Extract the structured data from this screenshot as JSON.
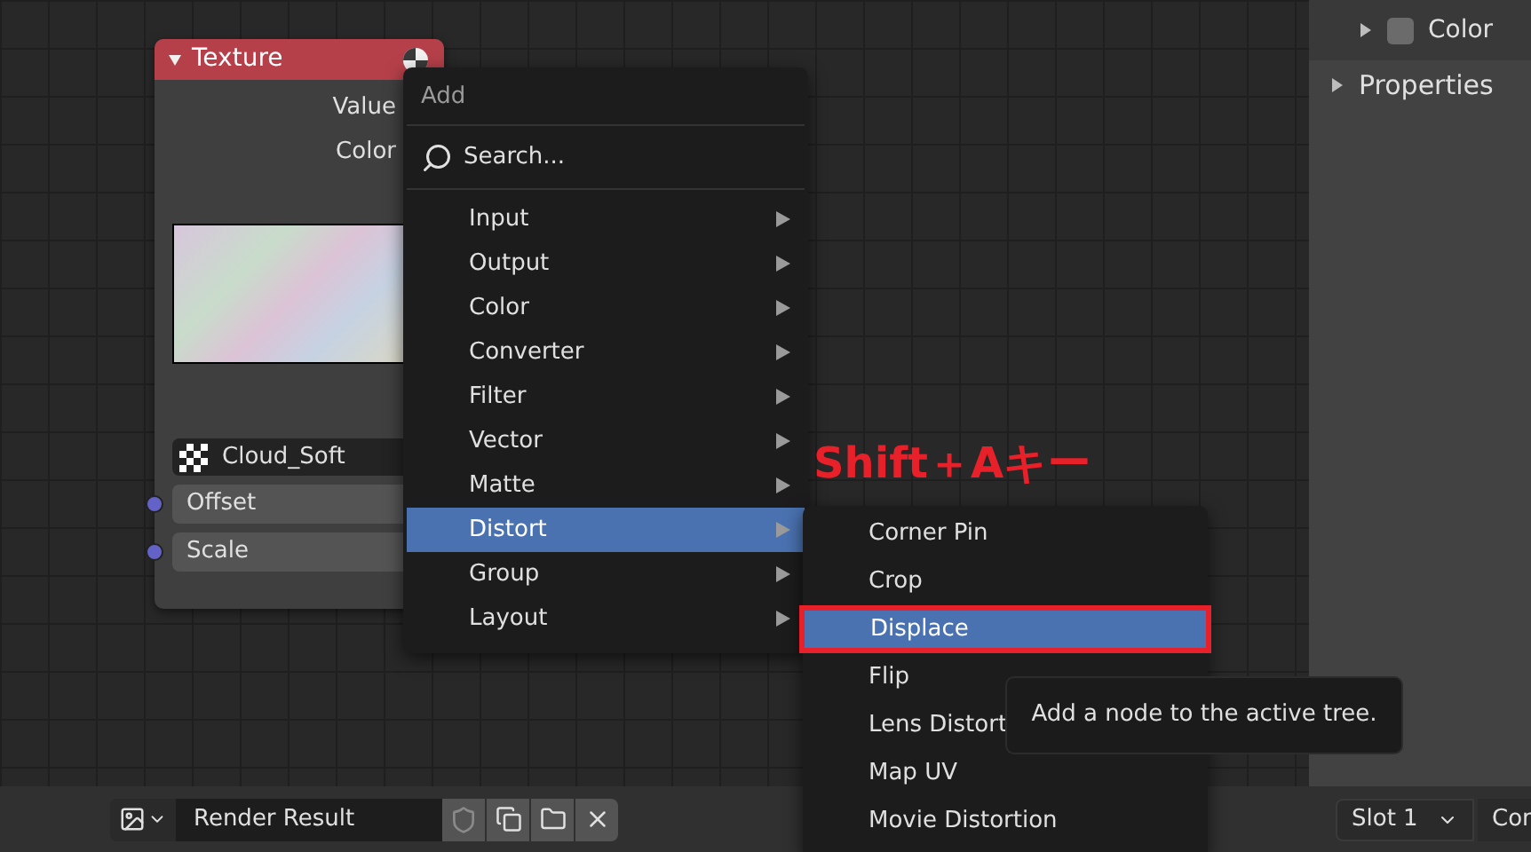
{
  "node": {
    "title": "Texture",
    "outputs": [
      "Value",
      "Color"
    ],
    "texture": "Cloud_Soft",
    "inputs": [
      "Offset",
      "Scale"
    ]
  },
  "add_menu": {
    "title": "Add",
    "search": "Search...",
    "items": [
      {
        "label": "Input",
        "selected": false
      },
      {
        "label": "Output",
        "selected": false
      },
      {
        "label": "Color",
        "selected": false
      },
      {
        "label": "Converter",
        "selected": false
      },
      {
        "label": "Filter",
        "selected": false
      },
      {
        "label": "Vector",
        "selected": false
      },
      {
        "label": "Matte",
        "selected": false
      },
      {
        "label": "Distort",
        "selected": true
      },
      {
        "label": "Group",
        "selected": false
      },
      {
        "label": "Layout",
        "selected": false
      }
    ]
  },
  "annotation": "Shift＋Aキー",
  "submenu": {
    "items": [
      {
        "label": "Corner Pin",
        "selected": false,
        "outlined": false
      },
      {
        "label": "Crop",
        "selected": false,
        "outlined": false
      },
      {
        "label": "Displace",
        "selected": true,
        "outlined": true
      },
      {
        "label": "Flip",
        "selected": false,
        "outlined": false
      },
      {
        "label": "Lens Distort",
        "selected": false,
        "outlined": false
      },
      {
        "label": "Map UV",
        "selected": false,
        "outlined": false
      },
      {
        "label": "Movie Distortion",
        "selected": false,
        "outlined": false
      }
    ]
  },
  "tooltip": "Add a node to the active tree.",
  "properties_panel": {
    "items": [
      {
        "kind": "swatch",
        "label": "Color",
        "expanded": false
      },
      {
        "kind": "section",
        "label": "Properties",
        "expanded": false
      }
    ]
  },
  "image_bar": {
    "image_name": "Render Result",
    "slot": "Slot 1",
    "column_2": "Cor"
  }
}
